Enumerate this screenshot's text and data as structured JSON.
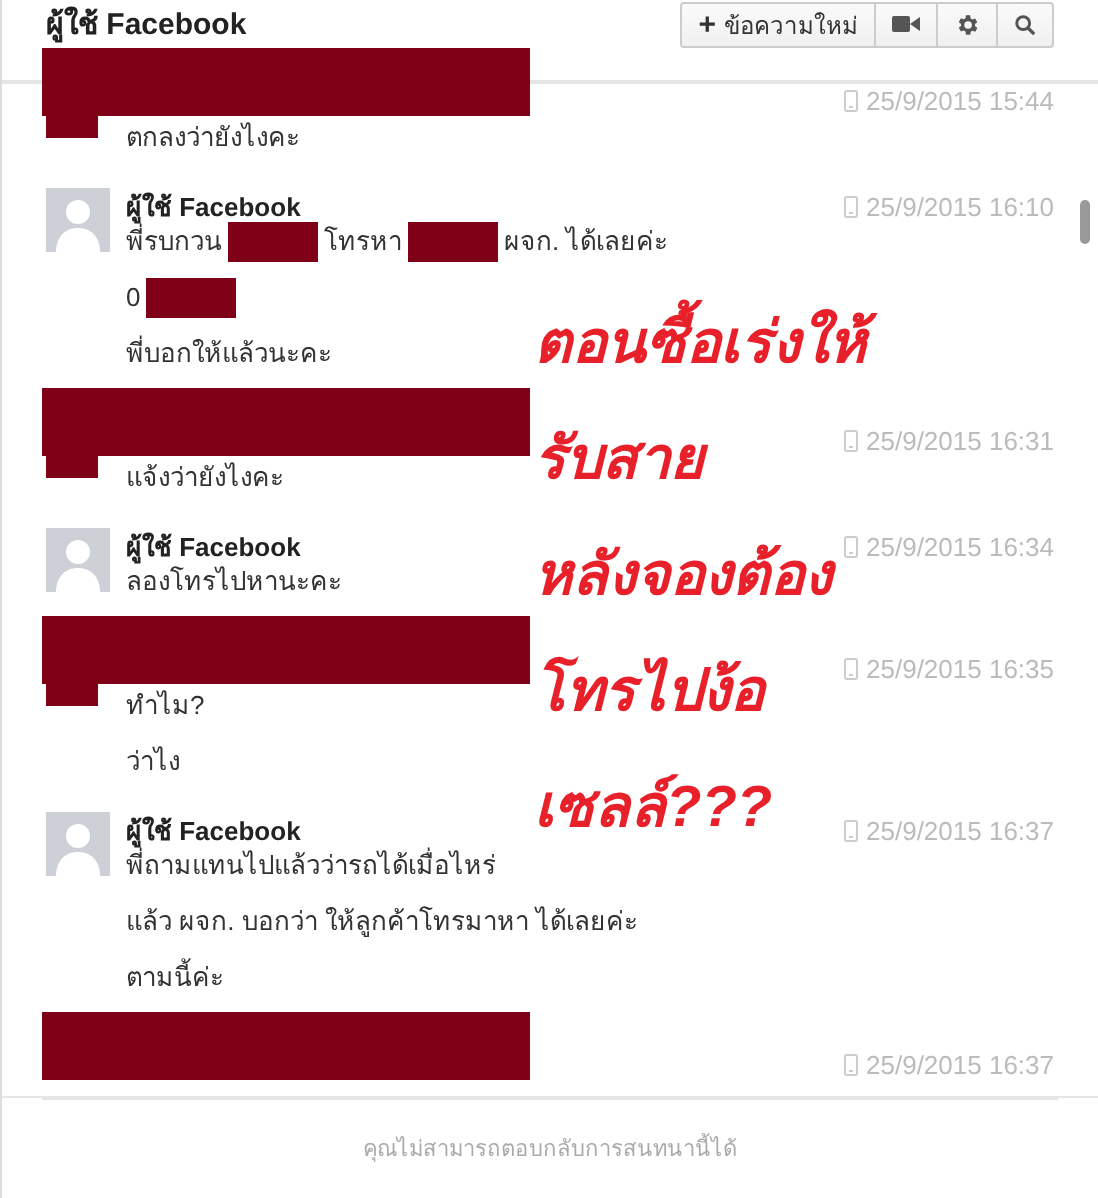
{
  "header": {
    "title": "ผู้ใช้ Facebook",
    "new_message_button": {
      "icon": "+",
      "label": "ข้อความใหม่"
    }
  },
  "messages": [
    {
      "kind": "redacted",
      "time": "25/9/2015 15:44",
      "lines": [
        [
          {
            "kind": "text",
            "text": "ตกลงว่ายังไงคะ"
          }
        ]
      ]
    },
    {
      "kind": "named",
      "name": "ผู้ใช้ Facebook",
      "time": "25/9/2015 16:10",
      "lines": [
        [
          {
            "kind": "text",
            "text": "พี่รบกวน"
          },
          {
            "kind": "redacted"
          },
          {
            "kind": "text",
            "text": "โทรหา"
          },
          {
            "kind": "redacted"
          },
          {
            "kind": "text",
            "text": "ผจก. ได้เลยค่ะ"
          }
        ],
        [
          {
            "kind": "text",
            "text": "0"
          },
          {
            "kind": "redacted"
          }
        ],
        [
          {
            "kind": "text",
            "text": "พี่บอกให้แล้วนะคะ"
          }
        ]
      ]
    },
    {
      "kind": "redacted",
      "time": "25/9/2015 16:31",
      "lines": [
        [
          {
            "kind": "text",
            "text": "แจ้งว่ายังไงคะ"
          }
        ]
      ]
    },
    {
      "kind": "named",
      "name": "ผู้ใช้ Facebook",
      "time": "25/9/2015 16:34",
      "lines": [
        [
          {
            "kind": "text",
            "text": "ลองโทรไปหานะคะ"
          }
        ]
      ]
    },
    {
      "kind": "redacted",
      "time": "25/9/2015 16:35",
      "lines": [
        [
          {
            "kind": "text",
            "text": "ทำไม?"
          }
        ],
        [
          {
            "kind": "text",
            "text": "ว่าไง"
          }
        ]
      ]
    },
    {
      "kind": "named",
      "name": "ผู้ใช้ Facebook",
      "time": "25/9/2015 16:37",
      "lines": [
        [
          {
            "kind": "text",
            "text": "พี่ถามแทนไปแล้วว่ารถได้เมื่อไหร่"
          }
        ],
        [
          {
            "kind": "text",
            "text": "แล้ว ผจก. บอกว่า ให้ลูกค้าโทรมาหา ได้เลยค่ะ"
          }
        ],
        [
          {
            "kind": "text",
            "text": "ตามนี้ค่ะ"
          }
        ]
      ]
    },
    {
      "kind": "redacted",
      "time": "25/9/2015 16:37"
    }
  ],
  "annotation": {
    "lines": [
      "ตอนซื้อเร่งให้",
      "รับสาย",
      "หลังจองต้อง",
      "โทรไปง้อ",
      "เซลล์???"
    ]
  },
  "footer": {
    "notice": "คุณไม่สามารถตอบกลับการสนทนานี้ได้"
  }
}
